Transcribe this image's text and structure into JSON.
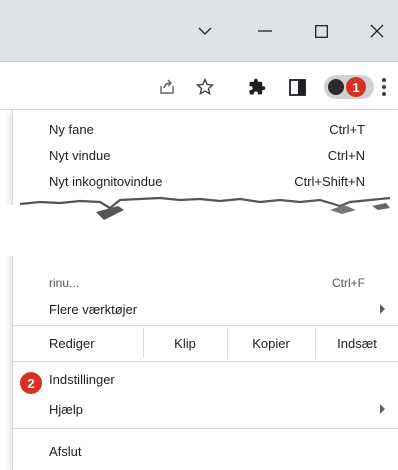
{
  "menu": {
    "new_tab": {
      "label": "Ny fane",
      "shortcut": "Ctrl+T"
    },
    "new_window": {
      "label": "Nyt vindue",
      "shortcut": "Ctrl+N"
    },
    "incognito": {
      "label": "Nyt inkognitovindue",
      "shortcut": "Ctrl+Shift+N"
    },
    "find": {
      "label": "rinu...",
      "shortcut": "Ctrl+F"
    },
    "more_tools": {
      "label": "Flere værktøjer"
    },
    "edit": {
      "label": "Rediger",
      "cut": "Klip",
      "copy": "Kopier",
      "paste": "Indsæt"
    },
    "settings": {
      "label": "Indstillinger"
    },
    "help": {
      "label": "Hjælp"
    },
    "exit": {
      "label": "Afslut"
    }
  },
  "badges": {
    "menu_button": "1",
    "settings": "2"
  },
  "colors": {
    "titlebar": "#dee1e6",
    "badge": "#d93025",
    "profile_pill": "#cfd2d7"
  },
  "icons": {
    "titlebar": [
      "chevron-down-icon",
      "minimize-icon",
      "maximize-icon",
      "close-icon"
    ],
    "toolbar": [
      "share-icon",
      "star-icon",
      "extensions-puzzle-icon",
      "side-panel-icon",
      "avatar-icon",
      "kebab-menu-icon"
    ]
  }
}
